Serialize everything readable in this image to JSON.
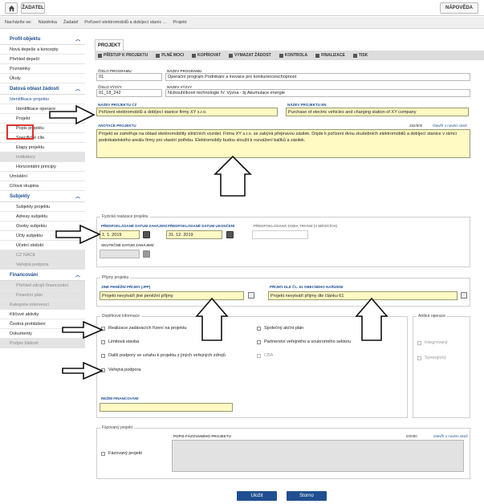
{
  "topbar": {
    "home_icon": "home-icon",
    "zadatel": "ŽADATEL",
    "napoveda": "NÁPOVĚDA"
  },
  "breadcrumbs": {
    "prefix": "Nacházíte se:",
    "items": [
      "Nástěnka",
      "Žadatel",
      "Pořízení elektromobilů a dobíjecí stanic ...",
      "Projekt"
    ]
  },
  "sidebar": {
    "profil_head": "Profil objektu",
    "profil_items": [
      "Nová depeše a koncepty",
      "Přehled depeší",
      "Poznámky",
      "Úkoly"
    ],
    "datova_head": "Datová oblast žádosti",
    "datova_items": [
      {
        "label": "Identifikace projektu",
        "sub": false,
        "dis": false
      },
      {
        "label": "Identifikace operace",
        "sub": true,
        "dis": false
      },
      {
        "label": "Projekt",
        "sub": true,
        "dis": false
      },
      {
        "label": "Popis projektu",
        "sub": true,
        "dis": false
      },
      {
        "label": "Specifické cíle",
        "sub": true,
        "dis": false
      },
      {
        "label": "Etapy projektu",
        "sub": true,
        "dis": false
      },
      {
        "label": "Indikátory",
        "sub": true,
        "dis": true
      },
      {
        "label": "Horizontální principy",
        "sub": true,
        "dis": false
      },
      {
        "label": "Umístění",
        "sub": false,
        "dis": false
      },
      {
        "label": "Cílová skupina",
        "sub": false,
        "dis": false
      }
    ],
    "subjekty_head": "Subjekty",
    "subjekty_items": [
      {
        "label": "Subjekty projektu",
        "dis": false
      },
      {
        "label": "Adresy subjektu",
        "dis": false
      },
      {
        "label": "Osoby subjektu",
        "dis": false
      },
      {
        "label": "Účty subjektu",
        "dis": false
      },
      {
        "label": "Účetní období",
        "dis": false
      },
      {
        "label": "CZ NACE",
        "dis": true
      },
      {
        "label": "Veřejná podpora",
        "dis": true
      }
    ],
    "financovani_head": "Financování",
    "financovani_items": [
      {
        "label": "Přehled zdrojů financování",
        "dis": true,
        "sub": true
      },
      {
        "label": "Finanční plán",
        "dis": true,
        "sub": true
      },
      {
        "label": "Kategorie intervencí",
        "dis": true,
        "sub": false
      },
      {
        "label": "Klíčové aktivity",
        "dis": false,
        "sub": false
      },
      {
        "label": "Čestná prohlášení",
        "dis": false,
        "sub": false
      },
      {
        "label": "Dokumenty",
        "dis": false,
        "sub": false
      },
      {
        "label": "Podpis žádosti",
        "dis": true,
        "sub": false
      }
    ]
  },
  "tab": "PROJEKT",
  "toolbar": [
    "PŘÍSTUP K PROJEKTU",
    "PLNÉ MOCI",
    "KOPÍROVAT",
    "VYMAZAT ŽÁDOST",
    "KONTROLA",
    "FINALIZACE",
    "TISK"
  ],
  "form": {
    "cislo_programu_label": "ČÍSLO PROGRAMU",
    "cislo_programu": "01",
    "nazev_programu_label": "NÁZEV PROGRAMU",
    "nazev_programu": "Operační program Podnikání a inovace pro konkurenceschopnost",
    "cislo_vyzvy_label": "ČÍSLO VÝZVY",
    "cislo_vyzvy": "01_18_242",
    "nazev_vyzvy_label": "NÁZEV VÝZVY",
    "nazev_vyzvy": "Nízkouhlíkové technologie IV. Výzva - bj Akumulace energie",
    "nazev_cz_label": "NÁZEV PROJEKTU CZ",
    "nazev_cz": "Pořízení elektromobilů a dobíjecí stanice firmy XY s.r.o.",
    "nazev_en_label": "NÁZEV PROJEKTU EN",
    "nazev_en": "Purchase of electric vehicles and charging station of XY company",
    "anotace_label": "ANOTACE PROJEKTU",
    "anotace_count": "282/500",
    "anotace_link": "Otevřít v novém okně",
    "anotace": "Projekt se zaměřuje na oblast elektromobility silničních vozidel. Firma XY s.r.o. se zabývá přepravou zásilek. Dojde k pořízení dvou zkušebních elektromobilů a dobíjecí stanice v rámci podnikatelského areálu firmy pro vlastní potřebu. Elektromobily budou sloužit k rozvážení balíků a zásilek."
  },
  "fyzicka": {
    "title": "Fyzická realizace projektu",
    "zahajeni_label": "PŘEDPOKLÁDANÉ DATUM ZAHÁJENÍ",
    "zahajeni": "1. 1. 2019",
    "ukonceni_label": "PŘEDPOKLÁDANÉ DATUM UKONČENÍ",
    "ukonceni": "31. 12. 2019",
    "doba_label": "PŘEDPOKLÁDANÁ DOBA TRVÁNÍ (V MĚSÍCÍCH)",
    "doba": "",
    "skutecne_label": "SKUTEČNÉ DATUM ZAHÁJENÍ",
    "skutecne": ""
  },
  "prijmy": {
    "title": "Příjmy projektu",
    "jine_label": "JINÉ PENĚŽNÍ PŘÍJMY (JPP)",
    "jine": "Projekt nevytváří jiné peněžní příjmy",
    "cl61_label": "PŘÍJMY DLE ČL. 61 OBECNÉHO NAŘÍZENÍ",
    "cl61": "Projekt nevytváří příjmy dle článku 61"
  },
  "doplnkove": {
    "title": "Doplňkové informace",
    "left": [
      {
        "label": "Realizace zadávacích řízení na projektu",
        "dis": false
      },
      {
        "label": "Limitová stavba",
        "dis": false
      },
      {
        "label": "Další podpory ve vztahu k projektu z jiných veřejných zdrojů",
        "dis": false
      },
      {
        "label": "Veřejná podpora",
        "dis": false
      }
    ],
    "right": [
      {
        "label": "Společný akční plán",
        "dis": false
      },
      {
        "label": "Partnerství veřejného a soukromého sektoru",
        "dis": false
      },
      {
        "label": "CBA",
        "dis": true
      }
    ],
    "rezim_label": "REŽIM FINANCOVÁNÍ",
    "rezim": ""
  },
  "atribut": {
    "title": "Atribut operace",
    "items": [
      "Integrovaný",
      "Synergický"
    ]
  },
  "fazovany": {
    "title": "Fázovaný projekt",
    "checkbox": "Fázovaný projekt",
    "popis_label": "POPIS FÁZOVANÉHO PROJEKTU",
    "count": "0/2000",
    "link": "Otevřít v novém okně"
  },
  "buttons": {
    "ulozit": "Uložit",
    "storno": "Storno"
  }
}
